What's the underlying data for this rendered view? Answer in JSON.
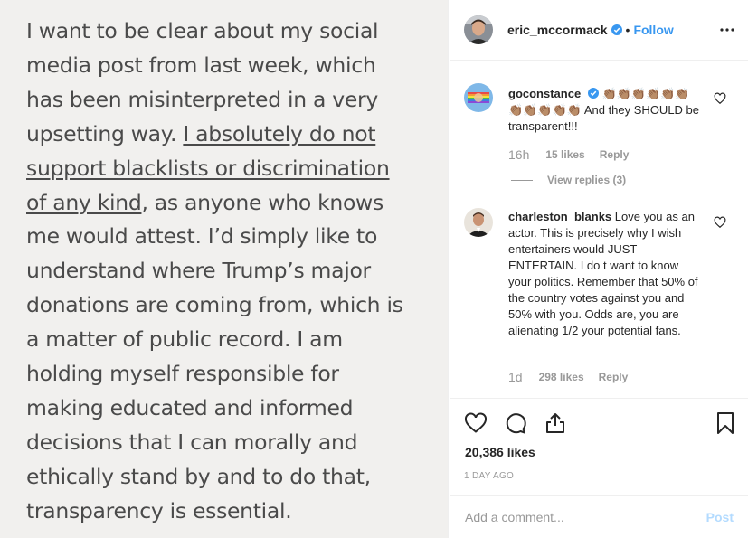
{
  "post_image": {
    "line_1": "I want to be clear about my social",
    "line_2": "media post from last week, which",
    "line_3": "has been misinterpreted in a very",
    "line_4a": "upsetting way. ",
    "line_4b": " I absolutely do not",
    "line_5": "support blacklists or discrimination",
    "line_6a": "of any kind",
    "line_6b": ", as anyone who knows",
    "line_7": "me would attest.  I’d simply like to",
    "line_8": "understand where Trump’s major",
    "line_9": "donations are coming from, which is",
    "line_10": "a matter of public record. I am",
    "line_11": "holding myself responsible for",
    "line_12": "making educated and informed",
    "line_13": "decisions that I can morally and",
    "line_14": "ethically stand by and to do that,",
    "line_15": "transparency is essential."
  },
  "header": {
    "username": "eric_mccormack",
    "separator": "•",
    "follow_label": "Follow"
  },
  "comments": [
    {
      "username": "goconstance",
      "emoji": "👏🏽👏🏽👏🏽👏🏽👏🏽👏🏽👏🏽👏🏽👏🏽👏🏽👏🏽",
      "text": " And they SHOULD be transparent!!!",
      "time": "16h",
      "likes": "15 likes",
      "reply": "Reply",
      "view_replies": "View replies (3)"
    },
    {
      "username": "charleston_blanks",
      "text": " Love you as an actor. This is precisely why I wish entertainers would JUST ENTERTAIN. I do t want to know your politics. Remember that 50% of the country votes against you and 50% with you. Odds are, you are alienating 1/2 your potential fans.",
      "time": "1d",
      "likes": "298 likes",
      "reply": "Reply"
    }
  ],
  "actions": {
    "likes_count": "20,386 likes",
    "time_ago": "1 DAY AGO"
  },
  "add_comment": {
    "placeholder": "Add a comment...",
    "post_label": "Post"
  },
  "colors": {
    "accent": "#3897f0",
    "muted": "#999999",
    "post_disabled": "#b3dbff"
  }
}
